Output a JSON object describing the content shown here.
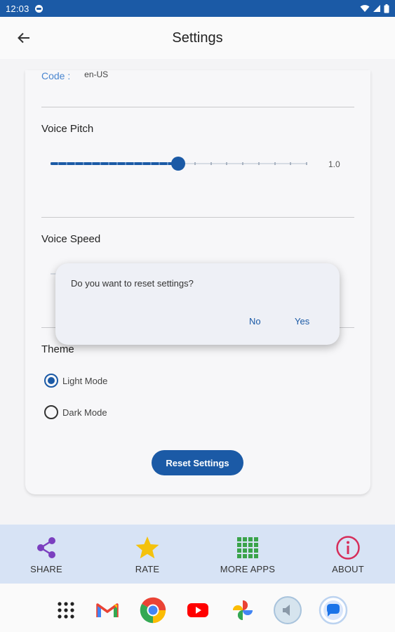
{
  "status_bar": {
    "time": "12:03"
  },
  "app_bar": {
    "title": "Settings"
  },
  "settings": {
    "code_label": "Code :",
    "code_value": "en-US",
    "voice_pitch": {
      "label": "Voice Pitch",
      "value_text": "1.0",
      "fraction": 0.5,
      "ticks": 16
    },
    "voice_speed": {
      "label": "Voice Speed"
    },
    "theme": {
      "label": "Theme",
      "options": [
        {
          "label": "Light Mode",
          "checked": true
        },
        {
          "label": "Dark Mode",
          "checked": false
        }
      ]
    },
    "reset_label": "Reset Settings"
  },
  "dialog": {
    "message": "Do you want to reset settings?",
    "no_label": "No",
    "yes_label": "Yes"
  },
  "bottom_nav": [
    {
      "label": "SHARE",
      "icon": "share-icon",
      "color": "#7b3fbf"
    },
    {
      "label": "RATE",
      "icon": "star-icon",
      "color": "#f4c20d"
    },
    {
      "label": "MORE APPS",
      "icon": "grid-icon",
      "color": "#3aa34a"
    },
    {
      "label": "ABOUT",
      "icon": "info-icon",
      "color": "#d62d5a"
    }
  ],
  "colors": {
    "primary": "#1b5aa6",
    "nav_bg": "#d7e3f5"
  }
}
